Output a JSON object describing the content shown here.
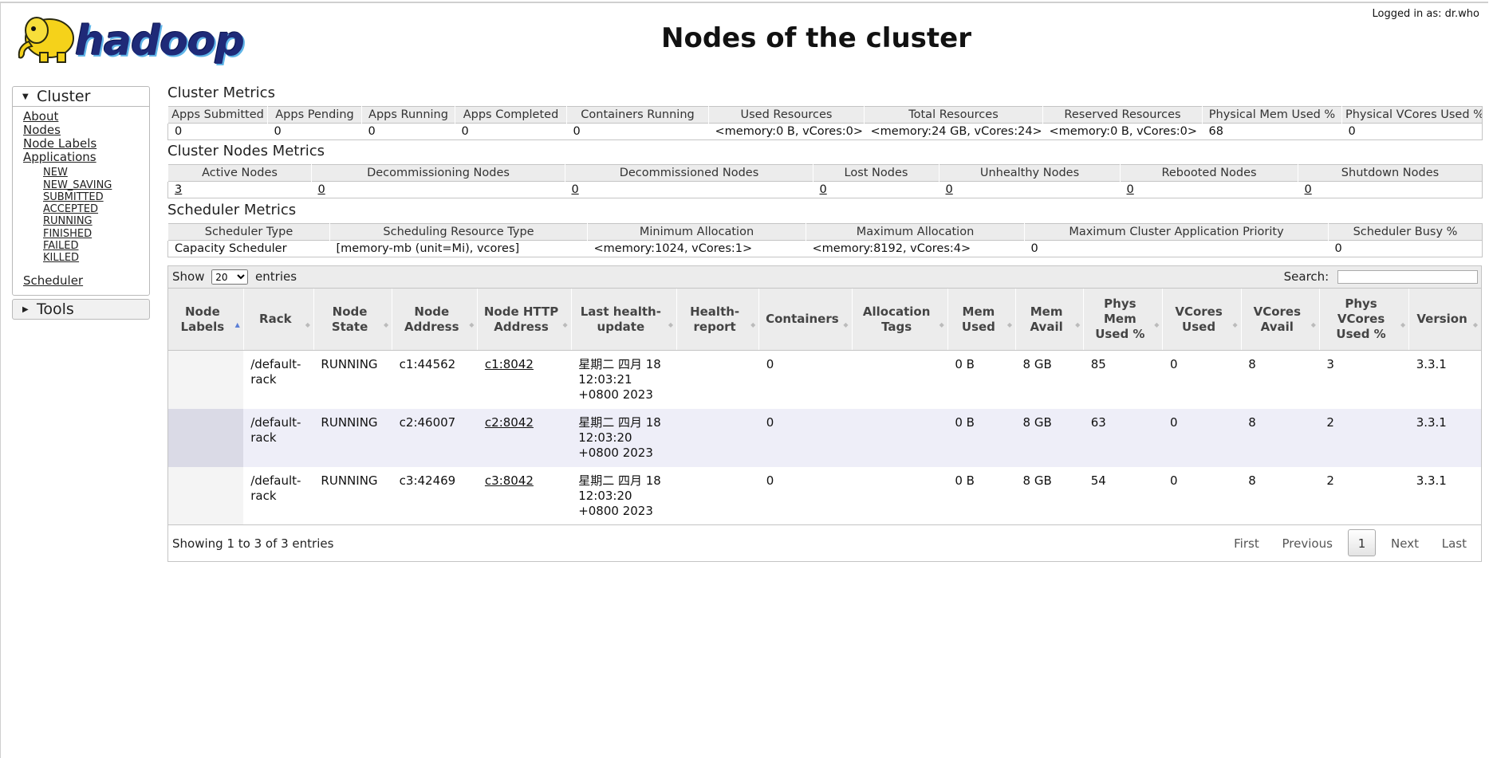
{
  "header": {
    "logo_text": "hadoop",
    "title": "Nodes of the cluster",
    "logged_in": "Logged in as: dr.who"
  },
  "sidebar": {
    "cluster_label": "Cluster",
    "tools_label": "Tools",
    "links": [
      "About",
      "Nodes",
      "Node Labels",
      "Applications"
    ],
    "app_states": [
      "NEW",
      "NEW_SAVING",
      "SUBMITTED",
      "ACCEPTED",
      "RUNNING",
      "FINISHED",
      "FAILED",
      "KILLED"
    ],
    "scheduler": "Scheduler"
  },
  "cluster_metrics": {
    "title": "Cluster Metrics",
    "headers": [
      "Apps Submitted",
      "Apps Pending",
      "Apps Running",
      "Apps Completed",
      "Containers Running",
      "Used Resources",
      "Total Resources",
      "Reserved Resources",
      "Physical Mem Used %",
      "Physical VCores Used %"
    ],
    "values": [
      "0",
      "0",
      "0",
      "0",
      "0",
      "<memory:0 B, vCores:0>",
      "<memory:24 GB, vCores:24>",
      "<memory:0 B, vCores:0>",
      "68",
      "0"
    ]
  },
  "node_metrics": {
    "title": "Cluster Nodes Metrics",
    "headers": [
      "Active Nodes",
      "Decommissioning Nodes",
      "Decommissioned Nodes",
      "Lost Nodes",
      "Unhealthy Nodes",
      "Rebooted Nodes",
      "Shutdown Nodes"
    ],
    "values": [
      "3",
      "0",
      "0",
      "0",
      "0",
      "0",
      "0"
    ]
  },
  "scheduler_metrics": {
    "title": "Scheduler Metrics",
    "headers": [
      "Scheduler Type",
      "Scheduling Resource Type",
      "Minimum Allocation",
      "Maximum Allocation",
      "Maximum Cluster Application Priority",
      "Scheduler Busy %"
    ],
    "values": [
      "Capacity Scheduler",
      "[memory-mb (unit=Mi), vcores]",
      "<memory:1024, vCores:1>",
      "<memory:8192, vCores:4>",
      "0",
      "0"
    ]
  },
  "nodes": {
    "show_label": "Show",
    "entries_label": "entries",
    "page_size": "20",
    "search_label": "Search:",
    "search_value": "",
    "columns": [
      "Node Labels",
      "Rack",
      "Node State",
      "Node Address",
      "Node HTTP Address",
      "Last health-update",
      "Health-report",
      "Containers",
      "Allocation Tags",
      "Mem Used",
      "Mem Avail",
      "Phys Mem Used %",
      "VCores Used",
      "VCores Avail",
      "Phys VCores Used %",
      "Version"
    ],
    "rows": [
      [
        "",
        "/default-rack",
        "RUNNING",
        "c1:44562",
        "c1:8042",
        "星期二 四月 18 12:03:21 +0800 2023",
        "",
        "0",
        "",
        "0 B",
        "8 GB",
        "85",
        "0",
        "8",
        "3",
        "3.3.1"
      ],
      [
        "",
        "/default-rack",
        "RUNNING",
        "c2:46007",
        "c2:8042",
        "星期二 四月 18 12:03:20 +0800 2023",
        "",
        "0",
        "",
        "0 B",
        "8 GB",
        "63",
        "0",
        "8",
        "2",
        "3.3.1"
      ],
      [
        "",
        "/default-rack",
        "RUNNING",
        "c3:42469",
        "c3:8042",
        "星期二 四月 18 12:03:20 +0800 2023",
        "",
        "0",
        "",
        "0 B",
        "8 GB",
        "54",
        "0",
        "8",
        "2",
        "3.3.1"
      ]
    ],
    "info": "Showing 1 to 3 of 3 entries",
    "pager": {
      "first": "First",
      "previous": "Previous",
      "current": "1",
      "next": "Next",
      "last": "Last"
    }
  }
}
